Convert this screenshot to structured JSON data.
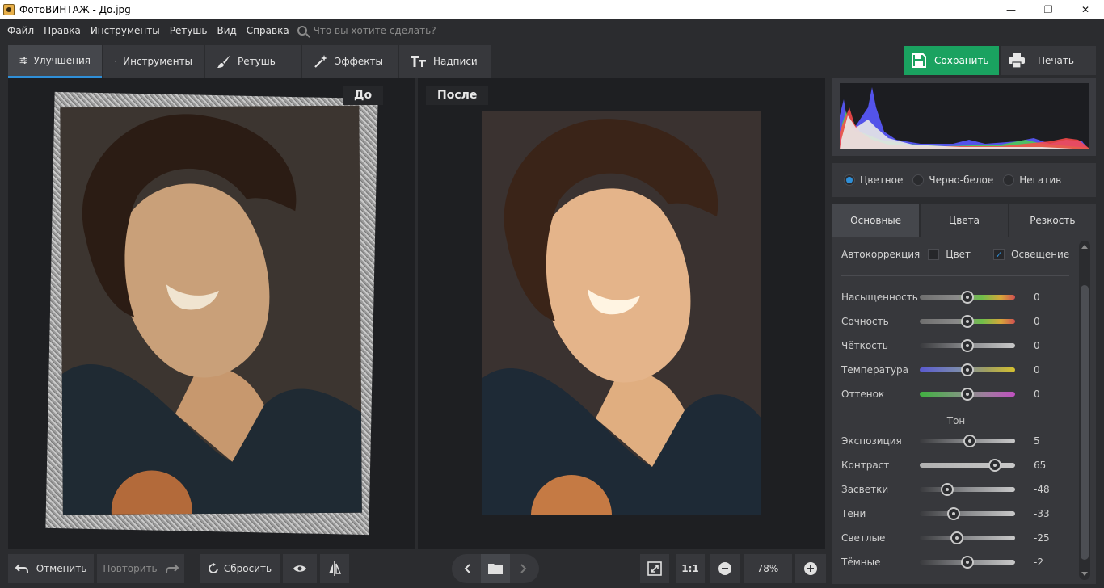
{
  "window": {
    "title": "ФотоВИНТАЖ - До.jpg",
    "minimize": "—",
    "maximize": "❐",
    "close": "✕"
  },
  "menu": {
    "items": [
      "Файл",
      "Правка",
      "Инструменты",
      "Ретушь",
      "Вид",
      "Справка"
    ],
    "search_placeholder": "Что вы хотите сделать?"
  },
  "tabs": [
    {
      "label": "Улучшения",
      "icon": "sliders-icon",
      "active": true
    },
    {
      "label": "Инструменты",
      "icon": "crop-icon",
      "active": false
    },
    {
      "label": "Ретушь",
      "icon": "brush-icon",
      "active": false
    },
    {
      "label": "Эффекты",
      "icon": "magic-wand-icon",
      "active": false
    },
    {
      "label": "Надписи",
      "icon": "text-icon",
      "active": false
    }
  ],
  "actions": {
    "save_label": "Сохранить",
    "print_label": "Печать"
  },
  "preview": {
    "before_label": "До",
    "after_label": "После"
  },
  "color_modes": {
    "options": [
      "Цветное",
      "Черно-белое",
      "Негатив"
    ],
    "selected": "Цветное"
  },
  "subtabs": [
    {
      "label": "Основные",
      "active": true
    },
    {
      "label": "Цвета",
      "active": false
    },
    {
      "label": "Резкость",
      "active": false
    }
  ],
  "autocorrection": {
    "label": "Автокоррекция",
    "color_label": "Цвет",
    "color_checked": false,
    "light_label": "Освещение",
    "light_checked": true
  },
  "adjustments": [
    {
      "label": "Насыщенность",
      "value": "0",
      "fraction": 0.5,
      "gradient": "linear-gradient(90deg,#6f6f6f,#8a8a8a 40%,#6fbf4a 65%,#d6a63a 85%,#d05050)"
    },
    {
      "label": "Сочность",
      "value": "0",
      "fraction": 0.5,
      "gradient": "linear-gradient(90deg,#6f6f6f,#8a8a8a 40%,#6fbf4a 65%,#d6a63a 85%,#d05050)"
    },
    {
      "label": "Чёткость",
      "value": "0",
      "fraction": 0.5,
      "gradient": "linear-gradient(90deg,#3a3b3e,#8a8b8e 50%,#c8c8c8)"
    },
    {
      "label": "Температура",
      "value": "0",
      "fraction": 0.5,
      "gradient": "linear-gradient(90deg,#5a5ad0,#7a8ab0 40%,#a0a060 70%,#d4c030)"
    },
    {
      "label": "Оттенок",
      "value": "0",
      "fraction": 0.5,
      "gradient": "linear-gradient(90deg,#40b040,#7a9a7a 40%,#a07aa0 70%,#c050c0)"
    }
  ],
  "tone": {
    "label": "Тон",
    "items": [
      {
        "label": "Экспозиция",
        "value": "5",
        "fraction": 0.525,
        "gradient": "linear-gradient(90deg,#3a3b3e,#8a8b8e 50%,#c8c8c8)"
      },
      {
        "label": "Контраст",
        "value": "65",
        "fraction": 0.79,
        "gradient": "linear-gradient(90deg,#b0b0b0,#c8c8c8)"
      },
      {
        "label": "Засветки",
        "value": "-48",
        "fraction": 0.29,
        "gradient": "linear-gradient(90deg,#3a3b3e,#8a8b8e 50%,#c8c8c8)"
      },
      {
        "label": "Тени",
        "value": "-33",
        "fraction": 0.36,
        "gradient": "linear-gradient(90deg,#3a3b3e,#8a8b8e 50%,#c8c8c8)"
      },
      {
        "label": "Светлые",
        "value": "-25",
        "fraction": 0.39,
        "gradient": "linear-gradient(90deg,#3a3b3e,#8a8b8e 50%,#c8c8c8)"
      },
      {
        "label": "Тёмные",
        "value": "-2",
        "fraction": 0.5,
        "gradient": "linear-gradient(90deg,#3a3b3e,#8a8b8e 50%,#c8c8c8)"
      }
    ]
  },
  "bottom": {
    "undo_label": "Отменить",
    "redo_label": "Повторить",
    "reset_label": "Сбросить",
    "actual_size_label": "1:1",
    "zoom": "78%"
  },
  "colors": {
    "accent": "#2f8fd8",
    "save": "#1aa260",
    "panel": "#37383c",
    "background": "#2b2c2f"
  }
}
